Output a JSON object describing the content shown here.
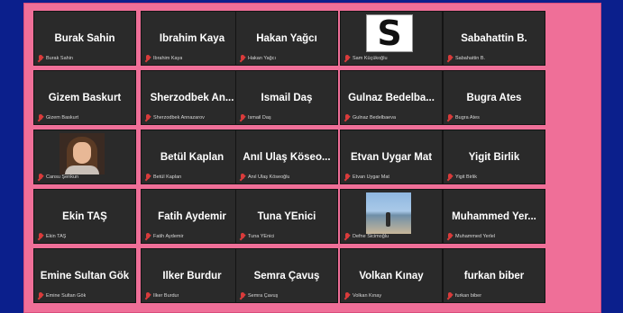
{
  "participants": [
    {
      "display": "Burak Sahin",
      "label": "Burak Sahin",
      "avatar": "text"
    },
    {
      "display": "Ibrahim Kaya",
      "label": "Ibrahim Kaya",
      "avatar": "text"
    },
    {
      "display": "Hakan Yağcı",
      "label": "Hakan Yağcı",
      "avatar": "text"
    },
    {
      "display": "S",
      "label": "Sam Küçükoğlu",
      "avatar": "logo-s"
    },
    {
      "display": "Sabahattin B.",
      "label": "Sabahattin B.",
      "avatar": "text"
    },
    {
      "display": "Gizem Baskurt",
      "label": "Gizem Baskurt",
      "avatar": "text"
    },
    {
      "display": "Sherzodbek An...",
      "label": "Sherzodbek Annazarov",
      "avatar": "text"
    },
    {
      "display": "İsmail Daş",
      "label": "İsmail Daş",
      "avatar": "text"
    },
    {
      "display": "Gulnaz Bedelba...",
      "label": "Gulnaz Bedelbaeva",
      "avatar": "text"
    },
    {
      "display": "Bugra Ates",
      "label": "Bugra Ates",
      "avatar": "text"
    },
    {
      "display": "",
      "label": "Cansu Şenkun",
      "avatar": "photo-woman"
    },
    {
      "display": "Betül Kaplan",
      "label": "Betül Kaplan",
      "avatar": "text"
    },
    {
      "display": "Anıl Ulaş Köseo...",
      "label": "Anıl Ulaş Köseoğlu",
      "avatar": "text"
    },
    {
      "display": "Etvan Uygar Mat",
      "label": "Etvan Uygar Mat",
      "avatar": "text"
    },
    {
      "display": "Yigit Birlik",
      "label": "Yigit Birlik",
      "avatar": "text"
    },
    {
      "display": "Ekin TAŞ",
      "label": "Ekin TAŞ",
      "avatar": "text"
    },
    {
      "display": "Fatih Aydemir",
      "label": "Fatih Aydemir",
      "avatar": "text"
    },
    {
      "display": "Tuna YEnici",
      "label": "Tuna YEnici",
      "avatar": "text"
    },
    {
      "display": "",
      "label": "Defne Sicimoğlu",
      "avatar": "photo-beach"
    },
    {
      "display": "Muhammed  Yer...",
      "label": "Muhammed Yerlel",
      "avatar": "text"
    },
    {
      "display": "Emine Sultan Gök",
      "label": "Emine Sultan Gök",
      "avatar": "text"
    },
    {
      "display": "Ilker Burdur",
      "label": "Ilker Burdur",
      "avatar": "text"
    },
    {
      "display": "Semra Çavuş",
      "label": "Semra Çavuş",
      "avatar": "text"
    },
    {
      "display": "Volkan Kınay",
      "label": "Volkan Kınay",
      "avatar": "text"
    },
    {
      "display": "furkan biber",
      "label": "furkan biber",
      "avatar": "text"
    }
  ],
  "colors": {
    "background": "#0b1f8c",
    "frame": "#ef6f98",
    "tile": "#2a2a2a",
    "muted_icon": "#d93b3b"
  }
}
